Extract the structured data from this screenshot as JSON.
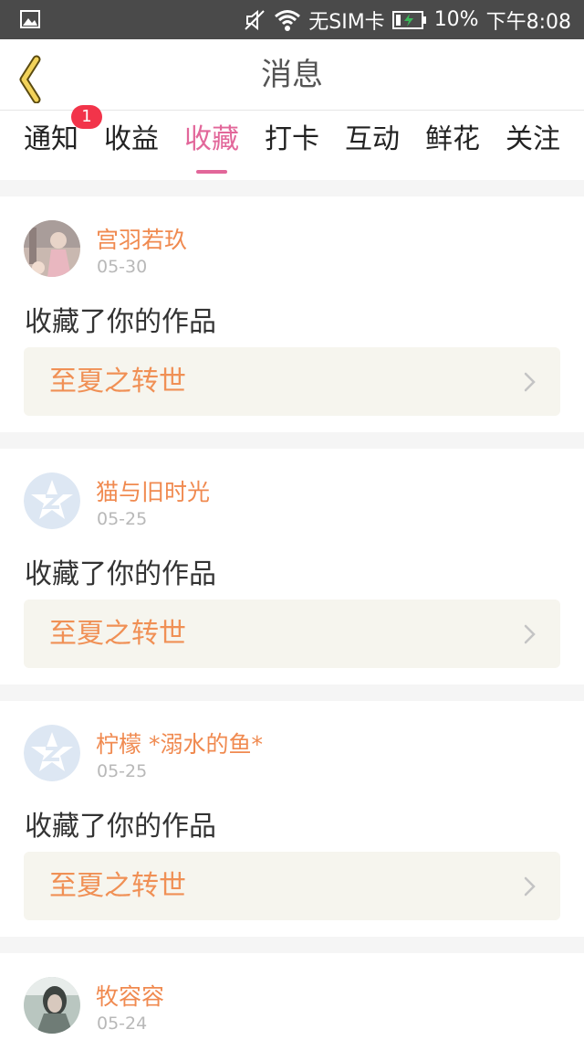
{
  "status_bar": {
    "sim_text": "无SIM卡",
    "battery_pct": "10%",
    "time": "下午8:08"
  },
  "header": {
    "title": "消息",
    "back_icon": "chevron-left-icon",
    "accent_color": "#e2679a"
  },
  "tabs": {
    "items": [
      {
        "label": "通知",
        "badge": "1"
      },
      {
        "label": "收益"
      },
      {
        "label": "收藏",
        "active": true
      },
      {
        "label": "打卡"
      },
      {
        "label": "互动"
      },
      {
        "label": "鲜花"
      },
      {
        "label": "关注"
      }
    ]
  },
  "messages": [
    {
      "user": "宫羽若玖",
      "date": "05-30",
      "action": "收藏了你的作品",
      "work": "至夏之转世",
      "avatar": "photo-avatar"
    },
    {
      "user": "猫与旧时光",
      "date": "05-25",
      "action": "收藏了你的作品",
      "work": "至夏之转世",
      "avatar": "default-avatar"
    },
    {
      "user": "柠檬 *溺水的鱼*",
      "date": "05-25",
      "action": "收藏了你的作品",
      "work": "至夏之转世",
      "avatar": "default-avatar"
    },
    {
      "user": "牧容容",
      "date": "05-24",
      "avatar": "photo-avatar"
    }
  ]
}
